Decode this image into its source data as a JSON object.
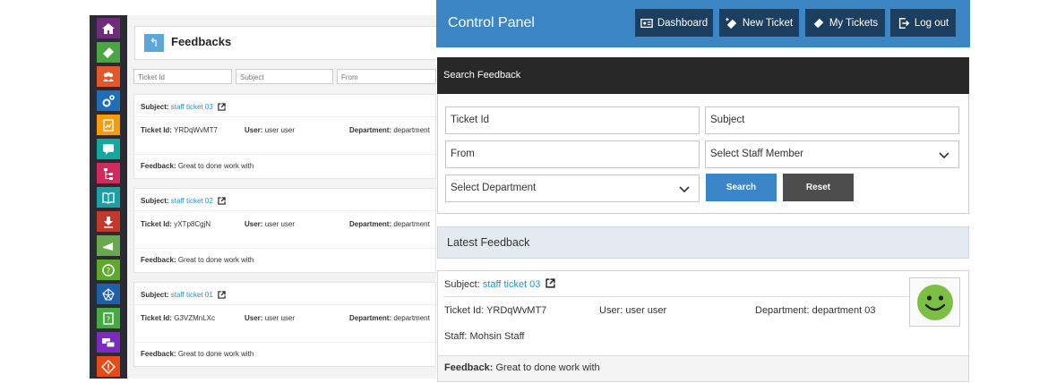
{
  "sidebar": {
    "items": [
      {
        "icon": "home-icon",
        "color": "#6e2c7a"
      },
      {
        "icon": "ticket-icon",
        "color": "#4aa543"
      },
      {
        "icon": "users-icon",
        "color": "#e2582b"
      },
      {
        "icon": "settings-icon",
        "color": "#1f6fb8"
      },
      {
        "icon": "report-icon",
        "color": "#f39c12"
      },
      {
        "icon": "feedback-icon",
        "color": "#13a89e"
      },
      {
        "icon": "hierarchy-icon",
        "color": "#d12a5c"
      },
      {
        "icon": "knowledge-book-icon",
        "color": "#1ba0a6"
      },
      {
        "icon": "download-icon",
        "color": "#c0392b"
      },
      {
        "icon": "announcement-icon",
        "color": "#6aa84f"
      },
      {
        "icon": "help-icon",
        "color": "#5ea82a"
      },
      {
        "icon": "network-icon",
        "color": "#1d5fa8"
      },
      {
        "icon": "faq-icon",
        "color": "#48a843"
      },
      {
        "icon": "chat-icon",
        "color": "#7b2cbf"
      },
      {
        "icon": "alert-icon",
        "color": "#e64a19"
      }
    ]
  },
  "left": {
    "title": "Feedbacks",
    "filters": [
      "Ticket Id",
      "Subject",
      "From"
    ],
    "cards": [
      {
        "subject_label": "Subject:",
        "subject": "staff ticket 03",
        "ticket_label": "Ticket Id:",
        "ticket_id": "YRDqWvMT7",
        "user_label": "User:",
        "user": "user user",
        "dept_label": "Department:",
        "dept": "department",
        "feedback_label": "Feedback:",
        "feedback": "Great to done work with"
      },
      {
        "subject_label": "Subject:",
        "subject": "staff ticket 02",
        "ticket_label": "Ticket Id:",
        "ticket_id": "yXTp8CgjN",
        "user_label": "User:",
        "user": "user user",
        "dept_label": "Department:",
        "dept": "department",
        "feedback_label": "Feedback:",
        "feedback": "Great to done work with"
      },
      {
        "subject_label": "Subject:",
        "subject": "staff ticket 01",
        "ticket_label": "Ticket Id:",
        "ticket_id": "G3VZMnLXc",
        "user_label": "User:",
        "user": "user user",
        "dept_label": "Department:",
        "dept": "department",
        "feedback_label": "Feedback:",
        "feedback": "Great to done work with"
      }
    ]
  },
  "header": {
    "title": "Control Panel",
    "buttons": [
      {
        "label": "Dashboard",
        "icon": "dashboard-icon"
      },
      {
        "label": "New Ticket",
        "icon": "new-ticket-icon"
      },
      {
        "label": "My Tickets",
        "icon": "my-tickets-icon"
      },
      {
        "label": "Log out",
        "icon": "logout-icon"
      }
    ]
  },
  "search": {
    "heading": "Search Feedback",
    "ticket_placeholder": "Ticket Id",
    "subject_placeholder": "Subject",
    "from_placeholder": "From",
    "staff_select": "Select Staff Member",
    "department_select": "Select Department",
    "search_label": "Search",
    "reset_label": "Reset"
  },
  "latest": {
    "heading": "Latest Feedback",
    "subject_label": "Subject:",
    "subject": "staff ticket 03",
    "ticket": "Ticket Id: YRDqWvMT7",
    "user": "User: user user",
    "department": "Department: department 03",
    "staff": "Staff: Mohsin  Staff",
    "feedback_label": "Feedback:",
    "feedback": "Great to done work with",
    "rating_icon": "smiley-face-icon"
  },
  "colors": {
    "topbar": "#3d86c6",
    "header_button": "#1c3f5f",
    "search_button": "#3a86c8",
    "reset_button": "#4d4d4d",
    "smiley": "#7bc043"
  }
}
